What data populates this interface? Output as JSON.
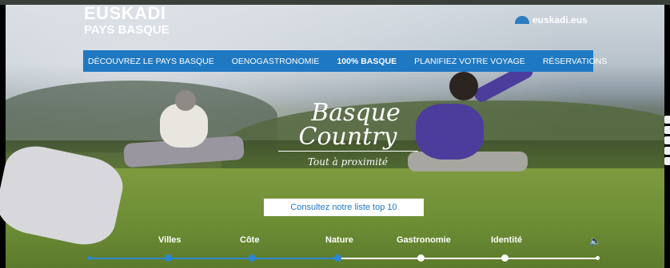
{
  "brand": {
    "name": "EUSKADI",
    "sub": "PAYS BASQUE",
    "site": "euskadi.eus"
  },
  "nav": {
    "items": [
      {
        "label": "DÉCOUVREZ LE PAYS BASQUE"
      },
      {
        "label": "OENOGASTRONOMIE"
      },
      {
        "label": "100% BASQUE",
        "active": true
      },
      {
        "label": "PLANIFIEZ VOTRE VOYAGE"
      },
      {
        "label": "RÉSERVATIONS"
      }
    ]
  },
  "hero": {
    "title_line1": "Basque",
    "title_line2": "Country",
    "tagline": "Tout à proximité",
    "cta_label": "Consultez notre liste top 10"
  },
  "timeline": {
    "labels": [
      "Villes",
      "Côte",
      "Nature",
      "Gastronomie",
      "Identité"
    ],
    "active_index": 2
  },
  "icons": {
    "sound": "speaker-icon",
    "site_logo": "euskadi-arc-icon"
  },
  "colors": {
    "accent": "#1f78c2",
    "progress": "#2a86d6"
  }
}
